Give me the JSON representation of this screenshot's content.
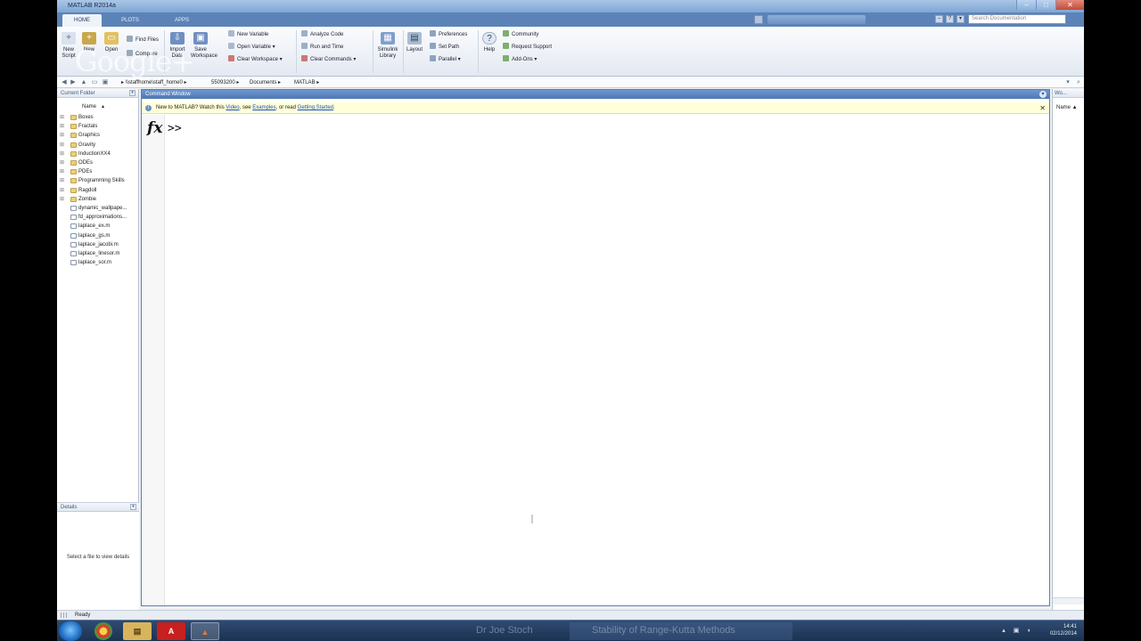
{
  "window": {
    "title": "MATLAB R2014a",
    "controls": [
      "–",
      "□",
      "✕"
    ]
  },
  "ribbon_tabs": [
    "HOME",
    "PLOTS",
    "APPS"
  ],
  "search_docs": {
    "placeholder": "Search Documentation"
  },
  "ribbon": {
    "file_group": {
      "new_script": "New Script",
      "new": "New",
      "open": "Open",
      "find_files": "Find Files",
      "compare": "Compare"
    },
    "variable_group": {
      "import_data": "Import Data",
      "save_workspace": "Save Workspace",
      "new_variable": "New Variable",
      "open_variable": "Open Variable",
      "clear_workspace": "Clear Workspace"
    },
    "code_group": {
      "analyze_code": "Analyze Code",
      "run_and_time": "Run and Time",
      "clear_commands": "Clear Commands"
    },
    "simulink_library": "Simulink Library",
    "layout": "Layout",
    "environment": {
      "preferences": "Preferences",
      "set_path": "Set Path",
      "parallel": "Parallel"
    },
    "help": "Help",
    "resources": {
      "community": "Community",
      "request_support": "Request Support",
      "add_ons": "Add-Ons"
    }
  },
  "watermark": "Google+",
  "address": {
    "path": [
      "\\\\staffhome\\staff_home0",
      "55093200",
      "Documents",
      "MATLAB"
    ]
  },
  "current_folder": {
    "title": "Current Folder",
    "column": "Name",
    "items": [
      {
        "name": "Boxes",
        "type": "folder"
      },
      {
        "name": "Fractals",
        "type": "folder"
      },
      {
        "name": "Graphics",
        "type": "folder"
      },
      {
        "name": "Gravity",
        "type": "folder"
      },
      {
        "name": "InductionXX4",
        "type": "folder"
      },
      {
        "name": "ODEs",
        "type": "folder"
      },
      {
        "name": "PDEs",
        "type": "folder"
      },
      {
        "name": "Programming Skills",
        "type": "folder"
      },
      {
        "name": "Ragdoll",
        "type": "folder"
      },
      {
        "name": "Zombie",
        "type": "folder"
      },
      {
        "name": "dynamic_wallpape...",
        "type": "file"
      },
      {
        "name": "fd_approximations...",
        "type": "file"
      },
      {
        "name": "laplace_ex.m",
        "type": "file"
      },
      {
        "name": "laplace_gs.m",
        "type": "file"
      },
      {
        "name": "laplace_jacobi.m",
        "type": "file"
      },
      {
        "name": "laplace_linesor.m",
        "type": "file"
      },
      {
        "name": "laplace_sor.m",
        "type": "file"
      }
    ]
  },
  "details": {
    "title": "Details",
    "empty_text": "Select a file to view details"
  },
  "command_window": {
    "title": "Command Window",
    "notice": {
      "prefix": "New to MATLAB? Watch this ",
      "video": "Video",
      "mid": ", see ",
      "examples": "Examples",
      "or": ", or read ",
      "getting_started": "Getting Started",
      "suffix": "."
    },
    "fx": "fx",
    "prompt": ">>"
  },
  "workspace": {
    "title": "Wo...",
    "column": "Name ▲"
  },
  "status": {
    "text": "Ready"
  },
  "taskbar": {
    "caption_left": "Dr Joe Stoch",
    "caption_right": "Stability of Range-Kutta Methods",
    "time": "14:41",
    "date": "02/12/2014"
  }
}
